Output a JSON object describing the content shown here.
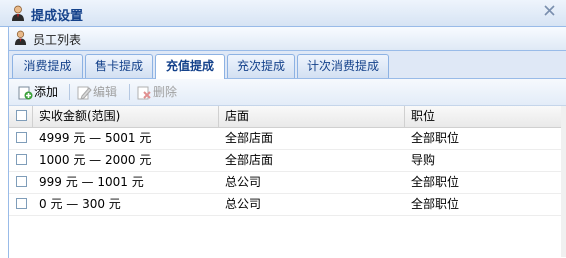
{
  "window": {
    "title": "提成设置"
  },
  "panel": {
    "title": "员工列表"
  },
  "tabs": [
    {
      "label": "消费提成"
    },
    {
      "label": "售卡提成"
    },
    {
      "label": "充值提成"
    },
    {
      "label": "充次提成"
    },
    {
      "label": "计次消费提成"
    }
  ],
  "active_tab": "充值提成",
  "toolbar": {
    "add_label": "添加",
    "edit_label": "编辑",
    "delete_label": "删除"
  },
  "table": {
    "columns": [
      "实收金额(范围)",
      "店面",
      "职位"
    ],
    "rows": [
      [
        "4999 元 — 5001 元",
        "全部店面",
        "全部职位"
      ],
      [
        "1000 元 — 2000 元",
        "全部店面",
        "导购"
      ],
      [
        "999 元 — 1001 元",
        "总公司",
        "全部职位"
      ],
      [
        "0 元 — 300 元",
        "总公司",
        "全部职位"
      ]
    ]
  },
  "colors": {
    "accent": "#15428b",
    "border": "#99bbe8",
    "tab_bg": "#dfe8f6"
  },
  "icons": [
    "user-icon",
    "close-icon",
    "add-icon",
    "edit-icon",
    "delete-icon"
  ]
}
